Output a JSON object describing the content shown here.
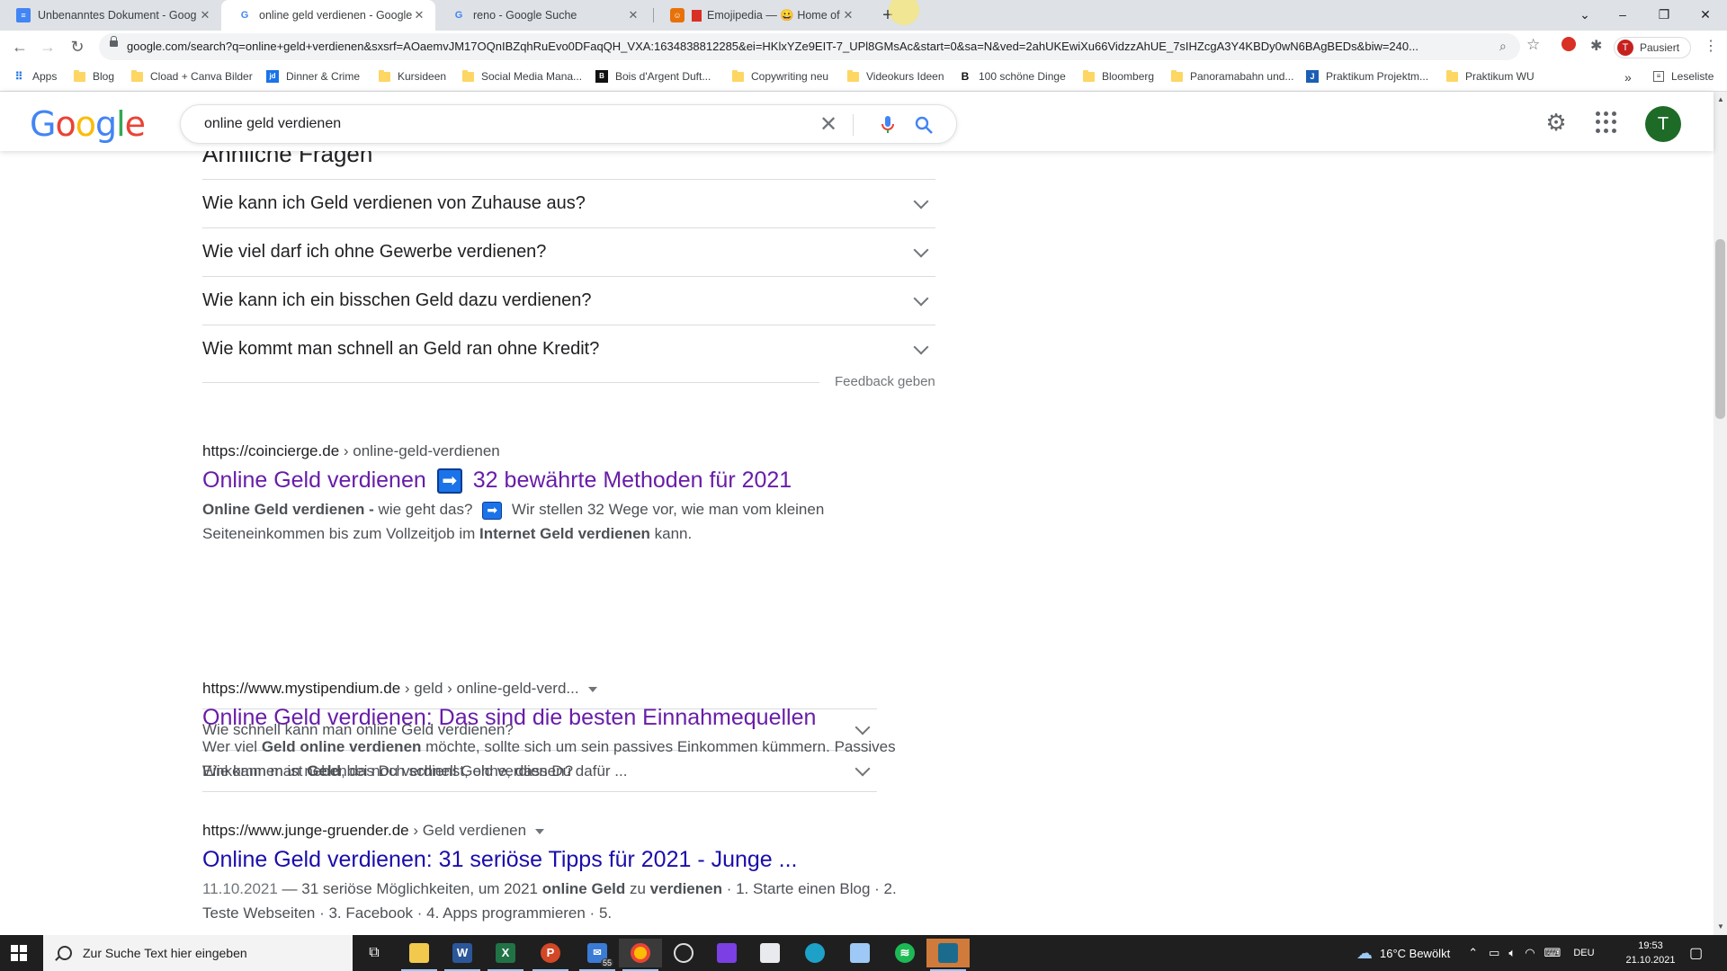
{
  "browser": {
    "tabs": [
      {
        "title": "Unbenanntes Dokument - Goog",
        "icon": "docs-icon"
      },
      {
        "title": "online geld verdienen - Google S",
        "icon": "google-icon"
      },
      {
        "title": "reno - Google Suche",
        "icon": "google-icon"
      },
      {
        "title": "Emojipedia — 😀 Home of E",
        "icon": "emojipedia-icon"
      }
    ],
    "url": "google.com/search?q=online+geld+verdienen&sxsrf=AOaemvJM17OQnIBZqhRuEvo0DFaqQH_VXA:1634838812285&ei=HKlxYZe9EIT-7_UPl8GMsAc&start=0&sa=N&ved=2ahUKEwiXu66VidzzAhUE_7sIHZcgA3Y4KBDy0wN6BAgBEDs&biw=240...",
    "profile_label": "Pausiert",
    "profile_initial": "T",
    "bookmarks": [
      {
        "label": "Apps",
        "icon": "apps-grid-icon"
      },
      {
        "label": "Blog",
        "icon": "folder-icon"
      },
      {
        "label": "Cload + Canva Bilder",
        "icon": "folder-icon"
      },
      {
        "label": "Dinner & Crime",
        "icon": "jd-icon"
      },
      {
        "label": "Kursideen",
        "icon": "folder-icon"
      },
      {
        "label": "Social Media Mana...",
        "icon": "folder-icon"
      },
      {
        "label": "Bois d'Argent Duft...",
        "icon": "bois-icon"
      },
      {
        "label": "Copywriting neu",
        "icon": "folder-icon"
      },
      {
        "label": "Videokurs Ideen",
        "icon": "folder-icon"
      },
      {
        "label": "100 schöne Dinge",
        "icon": "b-icon"
      },
      {
        "label": "Bloomberg",
        "icon": "folder-icon"
      },
      {
        "label": "Panoramabahn und...",
        "icon": "folder-icon"
      },
      {
        "label": "Praktikum Projektm...",
        "icon": "j-icon"
      },
      {
        "label": "Praktikum WU",
        "icon": "folder-icon"
      }
    ],
    "more_label": "»",
    "reading_list": "Leseliste"
  },
  "google": {
    "logo": "Google",
    "query": "online geld verdienen",
    "user_initial": "T"
  },
  "paa": {
    "title": "Ähnliche Fragen",
    "questions": [
      "Wie kann ich Geld verdienen von Zuhause aus?",
      "Wie viel darf ich ohne Gewerbe verdienen?",
      "Wie kann ich ein bisschen Geld dazu verdienen?",
      "Wie kommt man schnell an Geld ran ohne Kredit?"
    ],
    "feedback": "Feedback geben"
  },
  "results": [
    {
      "domain": "https://coincierge.de",
      "path": " › online-geld-verdienen",
      "title_a": "Online Geld verdienen",
      "title_arrow": "➡",
      "title_b": "32 bewährte Methoden für 2021",
      "snippet_a_bold": "Online Geld verdienen -",
      "snippet_a": " wie geht das? ",
      "snippet_arrow": "➡",
      "snippet_b": " Wir stellen 32 Wege vor, wie man vom kleinen Seiteneinkommen bis zum Vollzeitjob im ",
      "snippet_b_bold": "Internet Geld verdienen",
      "snippet_c": " kann.",
      "subquestions": [
        "Wie schnell kann man online Geld verdienen?",
        "Wie kann man nebenbei noch schnell Geld verdienen?"
      ]
    },
    {
      "domain": "https://www.mystipendium.de",
      "path": " › geld › online-geld-verd...",
      "title": "Online Geld verdienen: Das sind die besten Einnahmequellen",
      "s1": "Wer viel ",
      "s1_bold": "Geld online verdienen",
      "s2": " möchte, sollte sich um sein passives Einkommen kümmern. Passives Einkommen ist ",
      "s2_bold": "Geld",
      "s3": ", das Du verdienst, ohne, dass Du dafür ..."
    },
    {
      "domain": "https://www.junge-gruender.de",
      "path": " › Geld verdienen",
      "title": "Online Geld verdienen: 31 seriöse Tipps für 2021 - Junge ...",
      "date": "11.10.2021",
      "s1": " — 31 seriöse Möglichkeiten, um 2021 ",
      "s1_bold": "online Geld",
      "s2": " zu ",
      "s2_bold": "verdienen",
      "s3": " · 1. Starte einen Blog · 2. Teste Webseiten · 3. Facebook · 4. Apps programmieren · 5."
    }
  ],
  "taskbar": {
    "search_placeholder": "Zur Suche Text hier eingeben",
    "mail_badge": "55",
    "weather": "16°C  Bewölkt",
    "lang": "DEU",
    "time": "19:53",
    "date": "21.10.2021"
  }
}
